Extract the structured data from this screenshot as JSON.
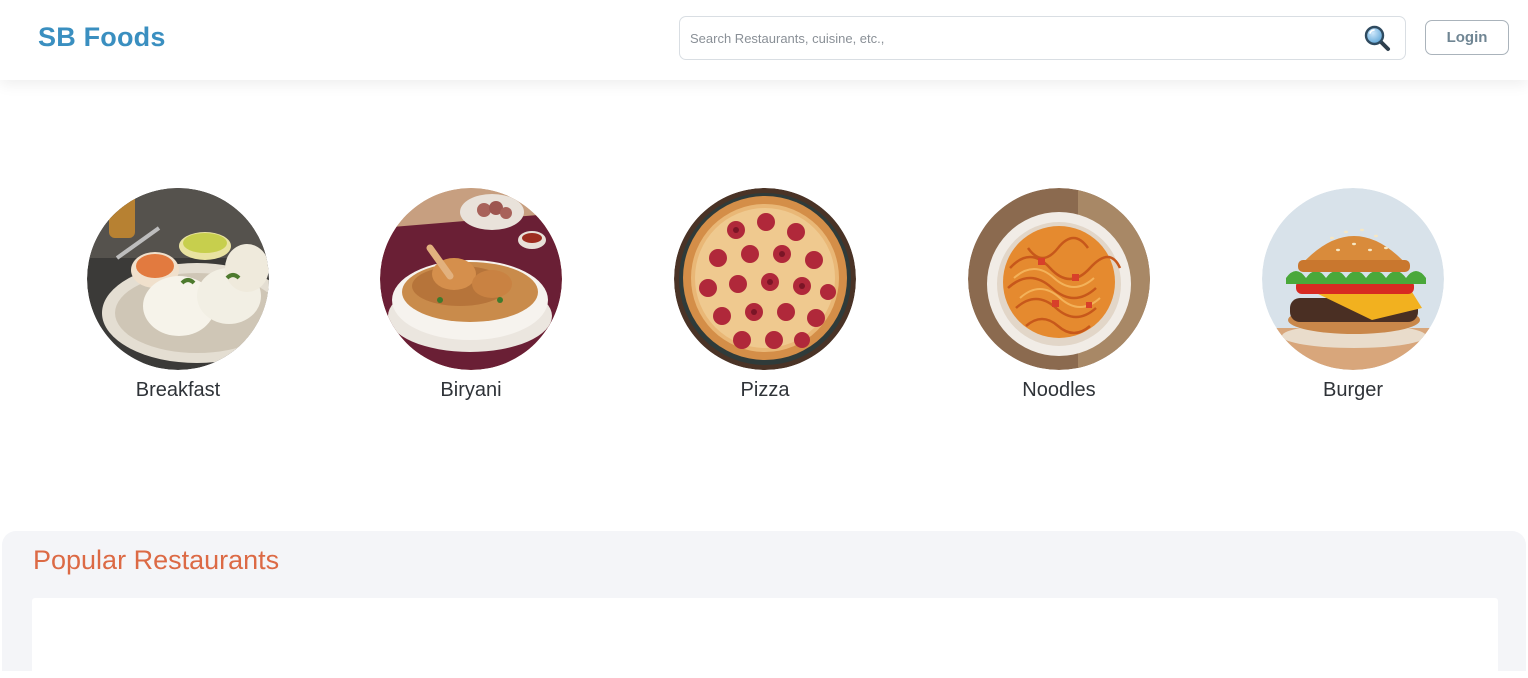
{
  "navbar": {
    "brand": "SB Foods",
    "search_placeholder": "Search Restaurants, cuisine, etc.,",
    "search_value": "",
    "search_icon": "magnifier-icon",
    "login_label": "Login"
  },
  "categories": [
    {
      "label": "Breakfast",
      "image": "breakfast-idli-image"
    },
    {
      "label": "Biryani",
      "image": "biryani-image"
    },
    {
      "label": "Pizza",
      "image": "pizza-image"
    },
    {
      "label": "Noodles",
      "image": "noodles-image"
    },
    {
      "label": "Burger",
      "image": "burger-image"
    }
  ],
  "popular": {
    "heading": "Popular Restaurants"
  },
  "colors": {
    "brand": "#3a8fc0",
    "heading_accent": "#dc6a45",
    "section_bg": "#f4f5f8"
  }
}
